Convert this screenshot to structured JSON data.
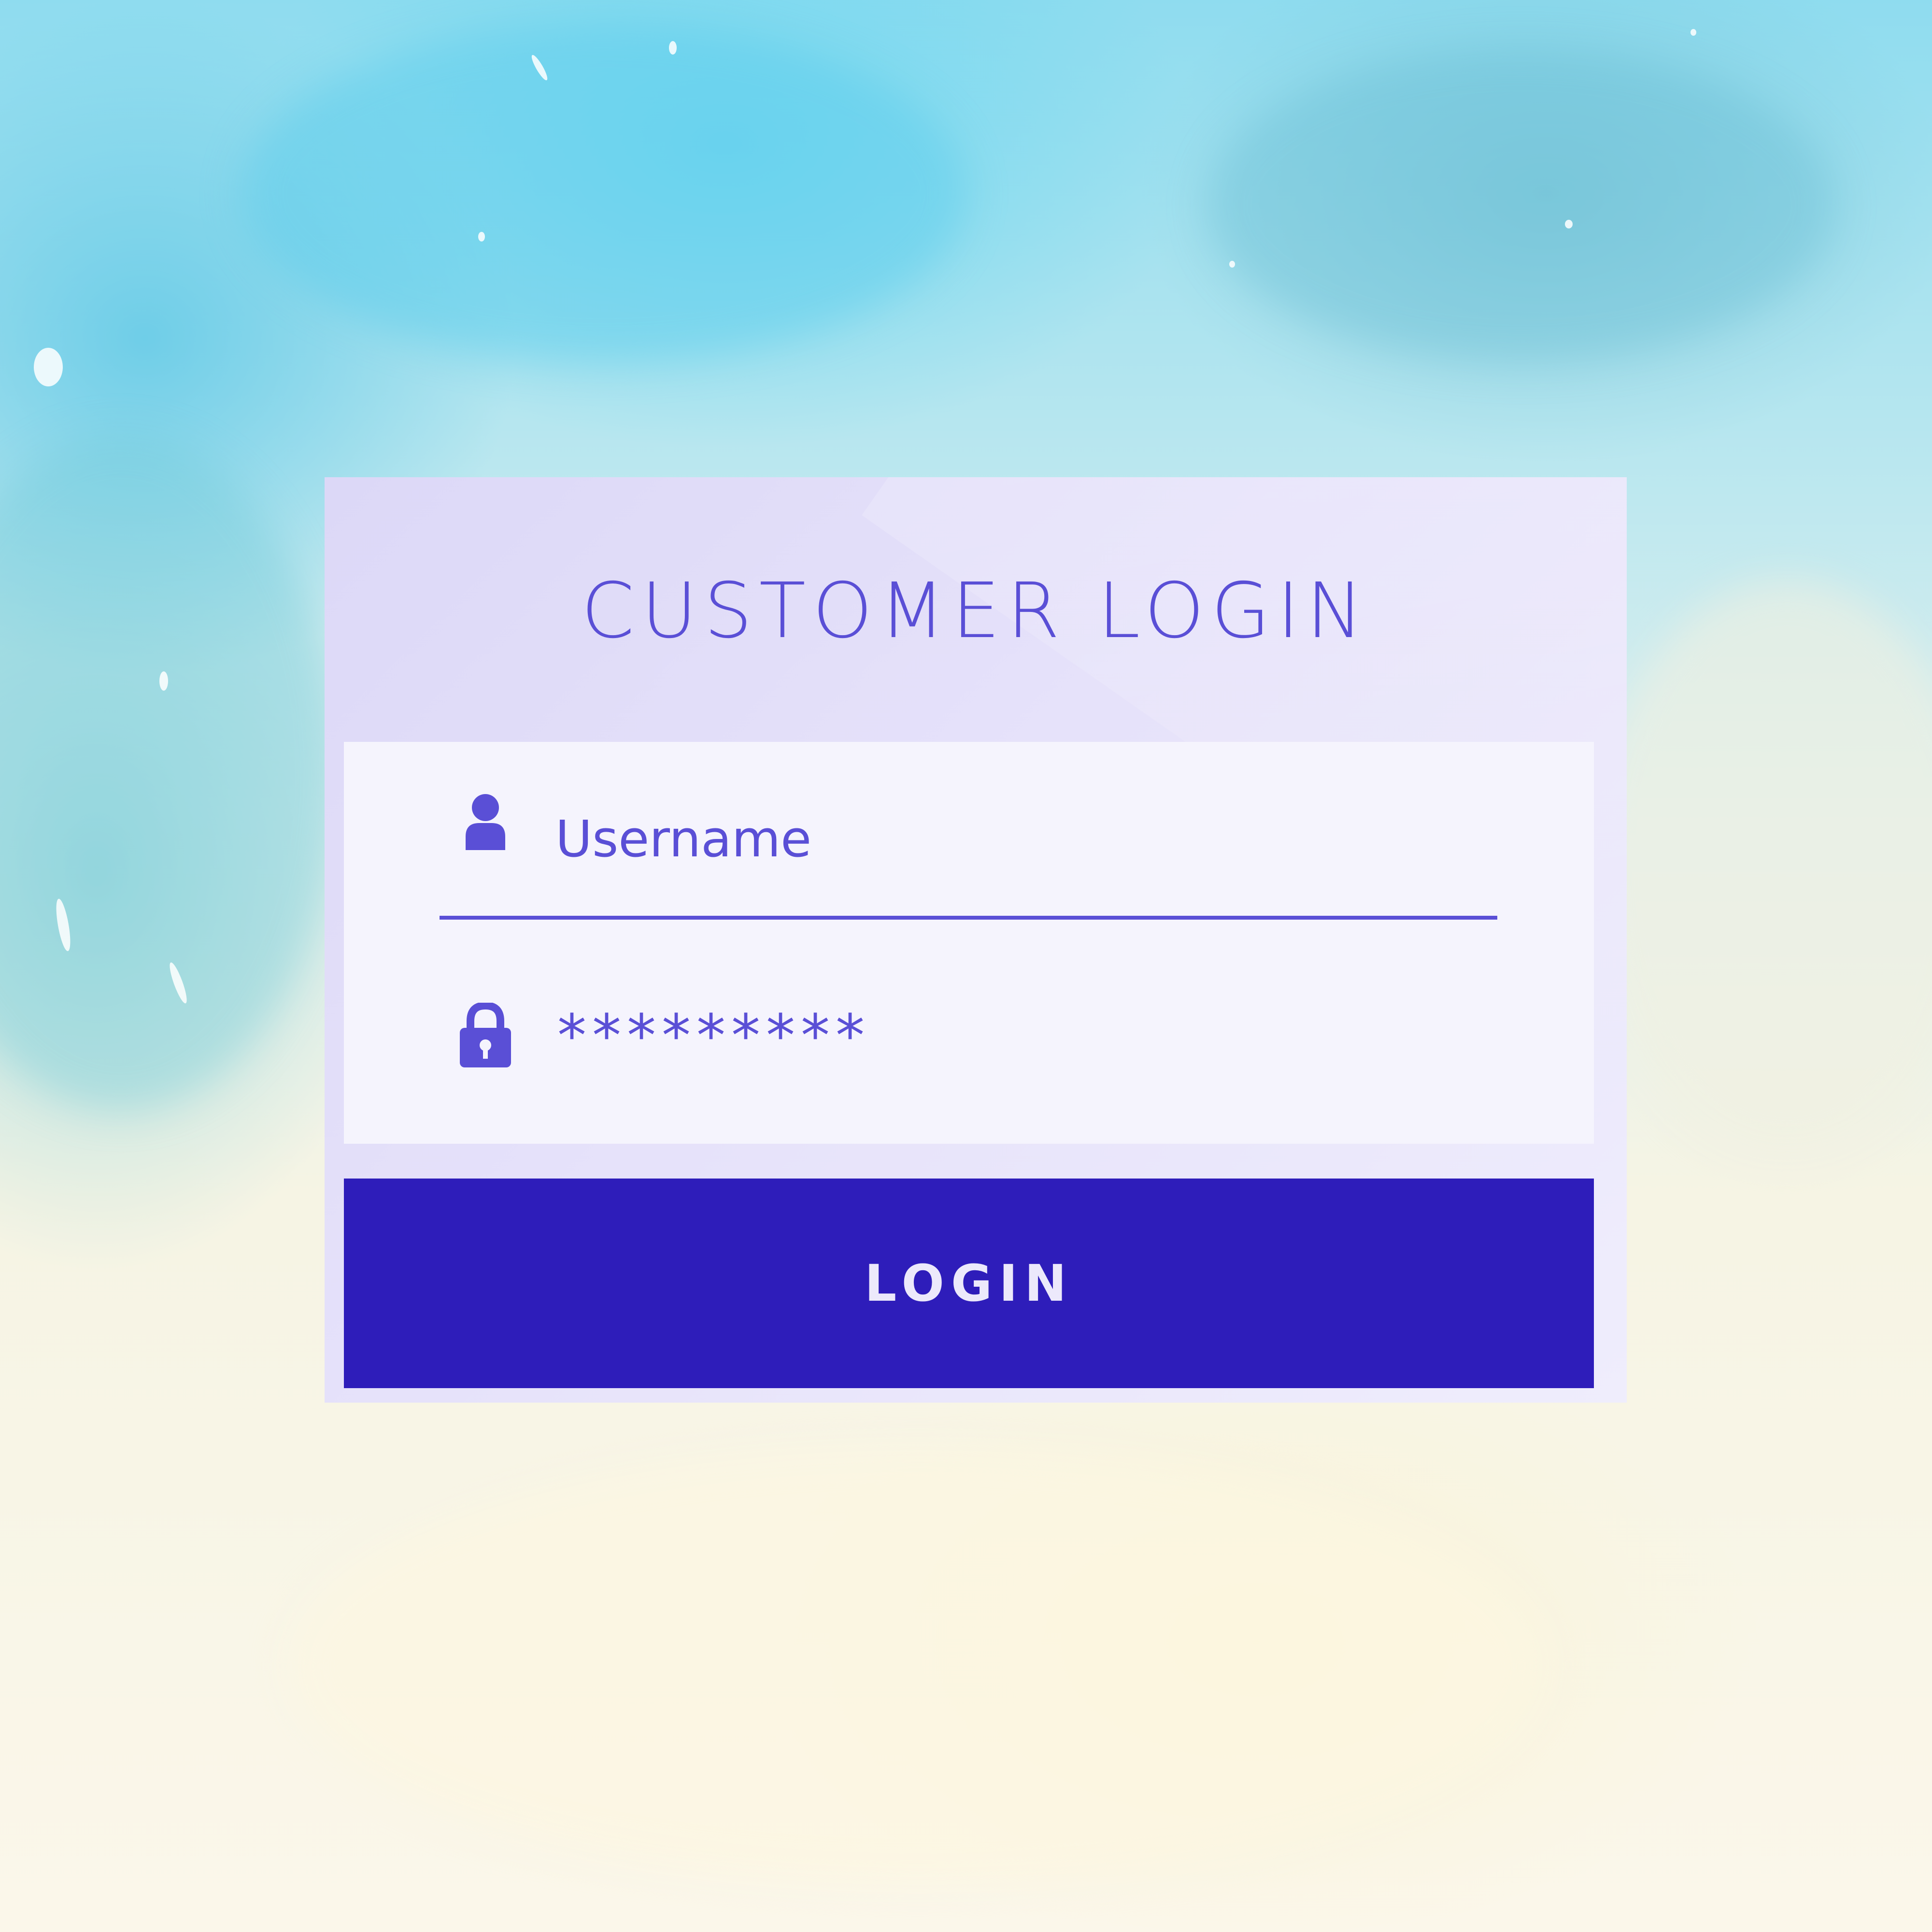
{
  "login_card": {
    "title": "CUSTOMER LOGIN",
    "username": {
      "value": "Username",
      "icon": "user-icon"
    },
    "password": {
      "value": "*********",
      "icon": "lock-icon"
    },
    "submit_label": "LOGIN"
  },
  "colors": {
    "accent": "#5a4fd6",
    "button": "#2e1dba",
    "button_text": "#ece9fb",
    "card": "#e6e2fa",
    "panel": "#f5f4fd"
  }
}
